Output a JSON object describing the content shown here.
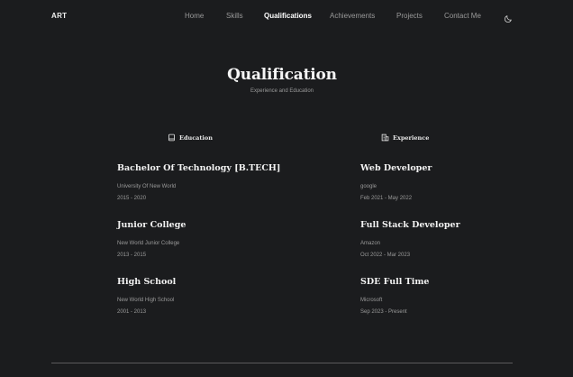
{
  "header": {
    "logo": "ART",
    "nav": [
      {
        "label": "Home",
        "active": false
      },
      {
        "label": "Skills",
        "active": false
      },
      {
        "label": "Qualifications",
        "active": true
      },
      {
        "label": "Achievements",
        "active": false
      },
      {
        "label": "Projects",
        "active": false
      },
      {
        "label": "Contact Me",
        "active": false
      }
    ],
    "theme_icon": "moon-icon"
  },
  "section": {
    "title": "Qualification",
    "subtitle": "Experience and Education"
  },
  "education": {
    "heading": "Education",
    "icon": "book-icon",
    "items": [
      {
        "title": "Bachelor Of Technology [B.TECH]",
        "org": "University Of New World",
        "date": "2015 - 2020"
      },
      {
        "title": "Junior College",
        "org": "New World Junior College",
        "date": "2013 - 2015"
      },
      {
        "title": "High School",
        "org": "New World High School",
        "date": "2001 - 2013"
      }
    ]
  },
  "experience": {
    "heading": "Experience",
    "icon": "building-icon",
    "items": [
      {
        "title": "Web Developer",
        "org": "google",
        "date": "Feb 2021 - May 2022"
      },
      {
        "title": "Full Stack Developer",
        "org": "Amazon",
        "date": "Oct 2022 - Mar 2023"
      },
      {
        "title": "SDE Full Time",
        "org": "Microsoft",
        "date": "Sep 2023 - Present"
      }
    ]
  },
  "colors": {
    "background": "#1b1c1e",
    "text": "#f2f2f2",
    "muted": "#9a9a9a",
    "divider": "#5a5a5c"
  }
}
